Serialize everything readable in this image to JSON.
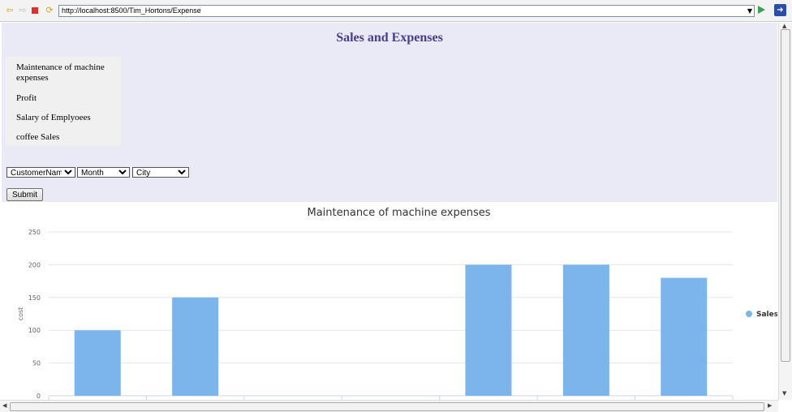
{
  "browser": {
    "url": "http://localhost:8500/Tim_Hortons/Expense",
    "icons": [
      "back-arrow-icon",
      "forward-arrow-icon",
      "stop-icon",
      "refresh-icon",
      "go-icon",
      "exit-icon"
    ]
  },
  "page": {
    "title": "Sales and Expenses",
    "menu": [
      "Maintenance of machine expenses",
      "Profit",
      "Salary of Emplyoees",
      "coffee Sales"
    ],
    "filters": {
      "customer": "CustomerName",
      "month": "Month",
      "city": "City"
    },
    "submit_label": "Submit"
  },
  "chart_data": {
    "type": "bar",
    "title": "Maintenance of machine expenses",
    "ylabel": "cost",
    "xlabel": "",
    "ylim": [
      0,
      250
    ],
    "yticks": [
      0,
      50,
      100,
      150,
      200,
      250
    ],
    "categories": [
      "",
      "",
      "",
      "",
      "",
      "",
      ""
    ],
    "series": [
      {
        "name": "Sales",
        "values": [
          100,
          150,
          0,
          0,
          200,
          200,
          180
        ],
        "color": "#7cb5ec"
      }
    ],
    "legend": "right",
    "grid": true
  }
}
